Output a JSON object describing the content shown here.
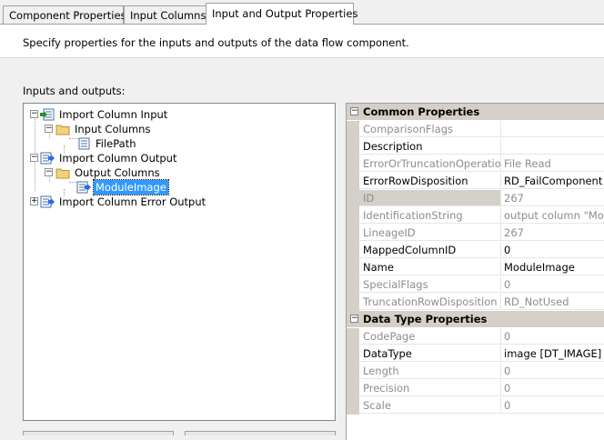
{
  "tabs": [
    {
      "label": "Component Properties"
    },
    {
      "label": "Input Columns"
    },
    {
      "label": "Input and Output Properties"
    }
  ],
  "description": "Specify properties for the inputs and outputs of the data flow component.",
  "io_label": "Inputs and outputs:",
  "tree": {
    "nodes": [
      {
        "label": "Import Column Input"
      },
      {
        "label": "Input Columns"
      },
      {
        "label": "FilePath"
      },
      {
        "label": "Import Column Output"
      },
      {
        "label": "Output Columns"
      },
      {
        "label": "ModuleImage"
      },
      {
        "label": "Import Column Error Output"
      }
    ]
  },
  "properties": {
    "common": {
      "title": "Common Properties",
      "rows": [
        {
          "name": "ComparisonFlags",
          "value": ""
        },
        {
          "name": "Description",
          "value": ""
        },
        {
          "name": "ErrorOrTruncationOperation",
          "value": "File Read"
        },
        {
          "name": "ErrorRowDisposition",
          "value": "RD_FailComponent"
        },
        {
          "name": "ID",
          "value": "267"
        },
        {
          "name": "IdentificationString",
          "value": "output column \"Mod"
        },
        {
          "name": "LineageID",
          "value": "267"
        },
        {
          "name": "MappedColumnID",
          "value": "0"
        },
        {
          "name": "Name",
          "value": "ModuleImage"
        },
        {
          "name": "SpecialFlags",
          "value": "0"
        },
        {
          "name": "TruncationRowDisposition",
          "value": "RD_NotUsed"
        }
      ]
    },
    "datatype": {
      "title": "Data Type Properties",
      "rows": [
        {
          "name": "CodePage",
          "value": "0"
        },
        {
          "name": "DataType",
          "value": "image [DT_IMAGE]"
        },
        {
          "name": "Length",
          "value": "0"
        },
        {
          "name": "Precision",
          "value": "0"
        },
        {
          "name": "Scale",
          "value": "0"
        }
      ]
    }
  },
  "colors": {
    "selection": "#3399ff",
    "category_band": "#d4d0c8",
    "readonly_text": "#8c8c8c"
  }
}
